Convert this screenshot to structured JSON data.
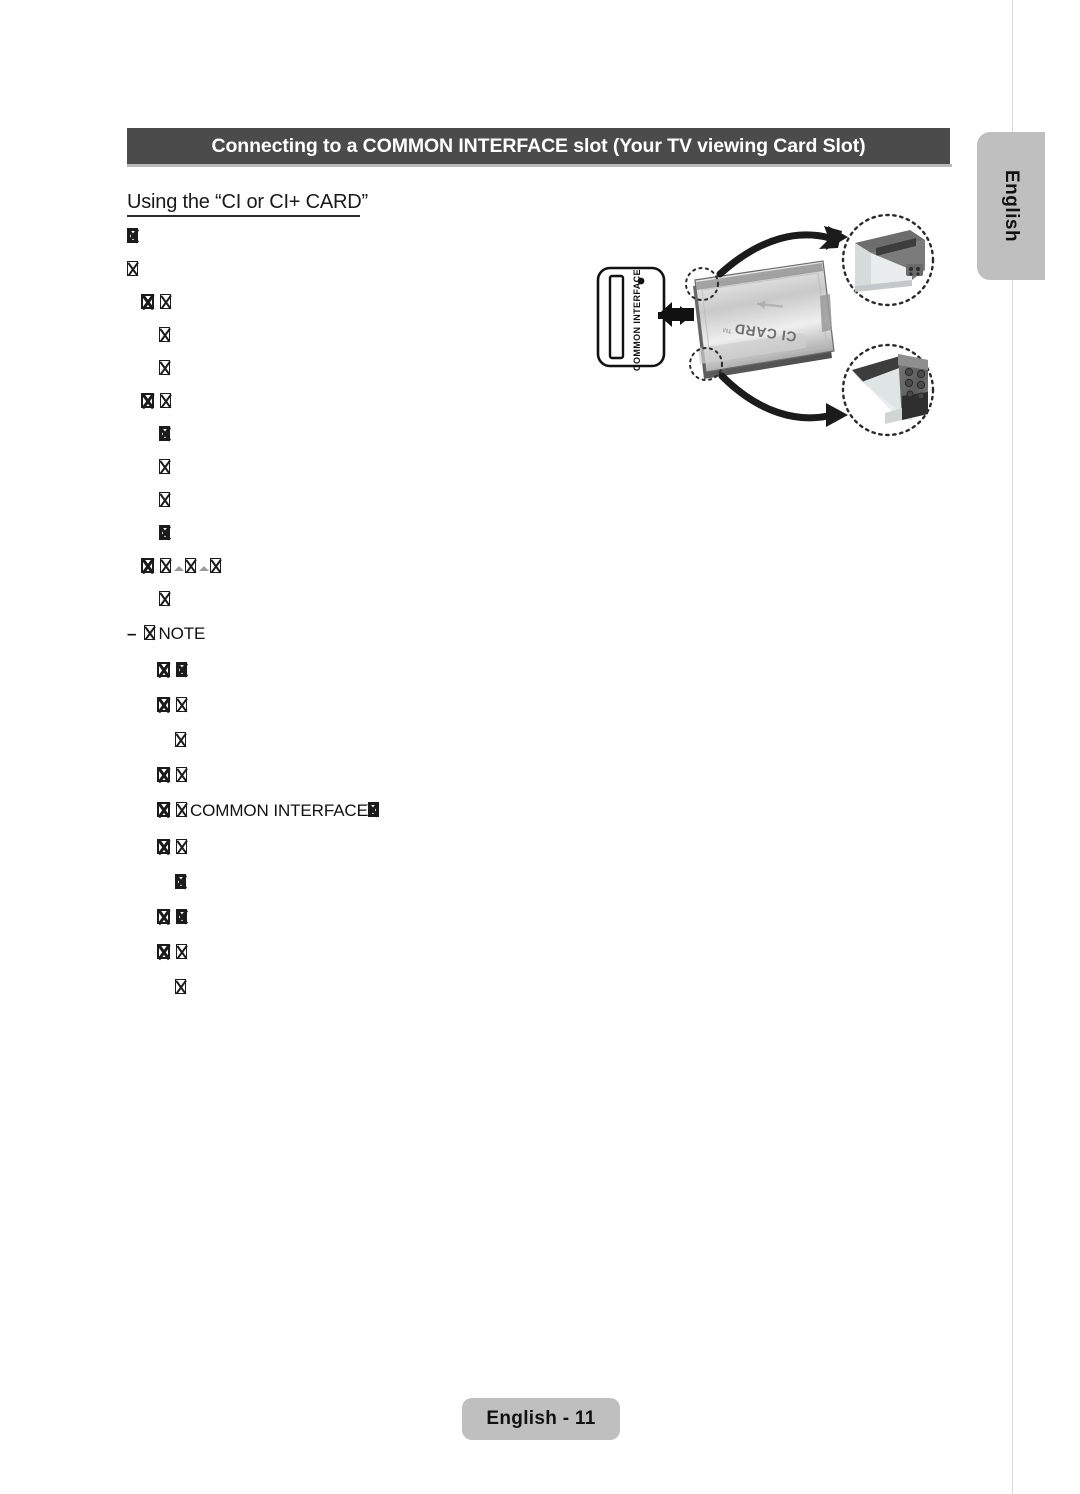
{
  "page": {
    "title_bar": "Connecting to a COMMON INTERFACE slot (Your TV viewing Card Slot)",
    "section_heading": "Using the “CI or CI+ CARD”",
    "side_tab_label": "English",
    "footer_label": "English - 11",
    "colors": {
      "title_bar_bg": "#4b4b4b",
      "title_bar_text": "#ffffff",
      "tab_bg": "#bfbfbf",
      "body_text": "#121212",
      "page_bg": "#ffffff"
    }
  },
  "body": {
    "note_dash": "–",
    "note_label": "NOTE",
    "common_interface_label": "COMMON INTERFACE",
    "lines": [
      {
        "indent": 0,
        "marker": "none",
        "glyphs": [
          "solid"
        ],
        "text": ""
      },
      {
        "indent": 0,
        "marker": "none",
        "glyphs": [
          "tofu"
        ],
        "text": ""
      },
      {
        "indent": 14,
        "marker": "bullet",
        "glyphs": [
          "tofu"
        ],
        "text": ""
      },
      {
        "indent": 32,
        "marker": "none",
        "glyphs": [
          "tofu"
        ],
        "text": ""
      },
      {
        "indent": 32,
        "marker": "none",
        "glyphs": [
          "tofu"
        ],
        "text": ""
      },
      {
        "indent": 14,
        "marker": "bullet",
        "glyphs": [
          "tofu"
        ],
        "text": ""
      },
      {
        "indent": 32,
        "marker": "none",
        "glyphs": [
          "solid"
        ],
        "text": ""
      },
      {
        "indent": 32,
        "marker": "none",
        "glyphs": [
          "tofu"
        ],
        "text": ""
      },
      {
        "indent": 32,
        "marker": "none",
        "glyphs": [
          "tofu"
        ],
        "text": ""
      },
      {
        "indent": 32,
        "marker": "none",
        "glyphs": [
          "solid"
        ],
        "text": ""
      },
      {
        "indent": 14,
        "marker": "bullet",
        "glyphs": [
          "path"
        ],
        "text": ""
      },
      {
        "indent": 32,
        "marker": "none",
        "glyphs": [
          "tofu"
        ],
        "text": ""
      }
    ],
    "note_lines": [
      {
        "indent": 30,
        "marker": "bullet",
        "glyphs": [
          "solid"
        ],
        "text": ""
      },
      {
        "indent": 30,
        "marker": "bullet",
        "glyphs": [
          "tofu"
        ],
        "text": ""
      },
      {
        "indent": 48,
        "marker": "none",
        "glyphs": [
          "tofu"
        ],
        "text": ""
      },
      {
        "indent": 30,
        "marker": "bullet",
        "glyphs": [
          "tofu"
        ],
        "text": ""
      },
      {
        "indent": 30,
        "marker": "bullet",
        "glyphs": [
          "ci"
        ],
        "text": "COMMON INTERFACE"
      },
      {
        "indent": 30,
        "marker": "bullet",
        "glyphs": [
          "tofu"
        ],
        "text": ""
      },
      {
        "indent": 48,
        "marker": "none",
        "glyphs": [
          "solid"
        ],
        "text": ""
      },
      {
        "indent": 30,
        "marker": "bullet",
        "glyphs": [
          "solid"
        ],
        "text": ""
      },
      {
        "indent": 30,
        "marker": "bullet",
        "glyphs": [
          "tofu"
        ],
        "text": ""
      },
      {
        "indent": 48,
        "marker": "none",
        "glyphs": [
          "tofu"
        ],
        "text": ""
      }
    ]
  },
  "illustration": {
    "slot_label": "COMMON INTERFACE",
    "card_label": "CI CARD",
    "card_label_suffix": "TM",
    "arrow_direction": "left",
    "callout_top": "card-edge-detail",
    "callout_bottom": "card-contacts-detail"
  }
}
